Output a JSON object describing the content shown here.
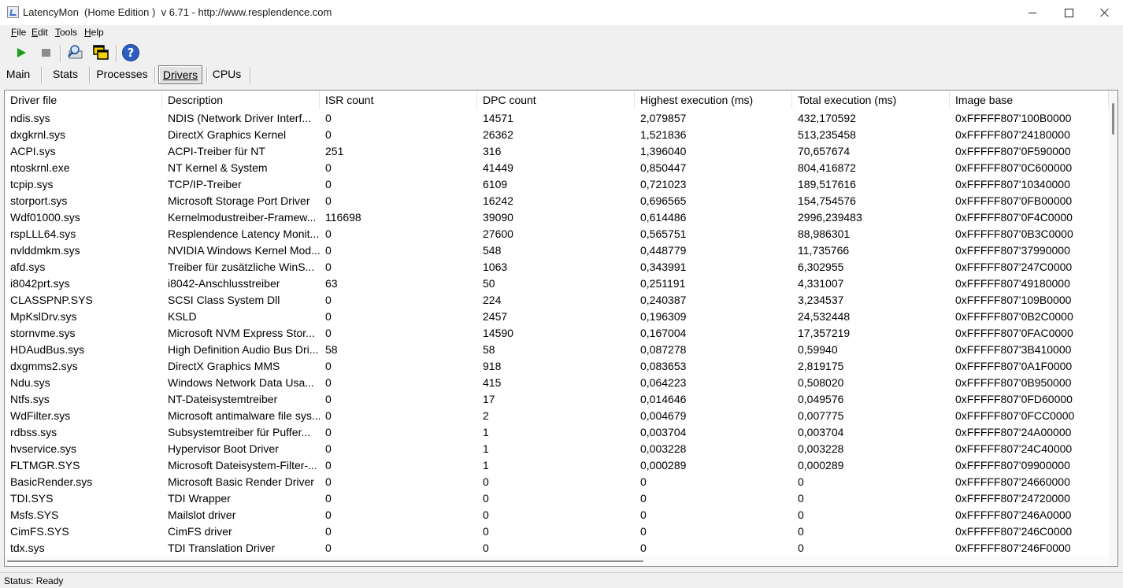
{
  "window": {
    "title": "LatencyMon  (Home Edition )  v 6.71 - http://www.resplendence.com"
  },
  "menu": [
    {
      "mnemonic": "F",
      "rest": "ile"
    },
    {
      "mnemonic": "E",
      "rest": "dit"
    },
    {
      "mnemonic": "T",
      "rest": "ools"
    },
    {
      "mnemonic": "H",
      "rest": "elp"
    }
  ],
  "toolbar": {
    "icons": [
      "play-icon",
      "stop-icon",
      "driver-search-icon",
      "windows-icon",
      "help-icon"
    ],
    "help_glyph": "?"
  },
  "tabs": [
    {
      "label": "Main",
      "active": false
    },
    {
      "label": "Stats",
      "active": false
    },
    {
      "label": "Processes",
      "active": false
    },
    {
      "label": "Drivers",
      "active": true
    },
    {
      "label": "CPUs",
      "active": false
    }
  ],
  "table": {
    "columns": [
      "Driver file",
      "Description",
      "ISR count",
      "DPC count",
      "Highest execution (ms)",
      "Total execution (ms)",
      "Image base"
    ],
    "rows": [
      [
        "ndis.sys",
        "NDIS (Network Driver Interf...",
        "0",
        "14571",
        "2,079857",
        "432,170592",
        "0xFFFFF807'100B0000"
      ],
      [
        "dxgkrnl.sys",
        "DirectX Graphics Kernel",
        "0",
        "26362",
        "1,521836",
        "513,235458",
        "0xFFFFF807'24180000"
      ],
      [
        "ACPI.sys",
        "ACPI-Treiber für NT",
        "251",
        "316",
        "1,396040",
        "70,657674",
        "0xFFFFF807'0F590000"
      ],
      [
        "ntoskrnl.exe",
        "NT Kernel & System",
        "0",
        "41449",
        "0,850447",
        "804,416872",
        "0xFFFFF807'0C600000"
      ],
      [
        "tcpip.sys",
        "TCP/IP-Treiber",
        "0",
        "6109",
        "0,721023",
        "189,517616",
        "0xFFFFF807'10340000"
      ],
      [
        "storport.sys",
        "Microsoft Storage Port Driver",
        "0",
        "16242",
        "0,696565",
        "154,754576",
        "0xFFFFF807'0FB00000"
      ],
      [
        "Wdf01000.sys",
        "Kernelmodustreiber-Framew...",
        "116698",
        "39090",
        "0,614486",
        "2996,239483",
        "0xFFFFF807'0F4C0000"
      ],
      [
        "rspLLL64.sys",
        "Resplendence Latency Monit...",
        "0",
        "27600",
        "0,565751",
        "88,986301",
        "0xFFFFF807'0B3C0000"
      ],
      [
        "nvlddmkm.sys",
        "NVIDIA Windows Kernel Mod...",
        "0",
        "548",
        "0,448779",
        "11,735766",
        "0xFFFFF807'37990000"
      ],
      [
        "afd.sys",
        "Treiber für zusätzliche WinS...",
        "0",
        "1063",
        "0,343991",
        "6,302955",
        "0xFFFFF807'247C0000"
      ],
      [
        "i8042prt.sys",
        "i8042-Anschlusstreiber",
        "63",
        "50",
        "0,251191",
        "4,331007",
        "0xFFFFF807'49180000"
      ],
      [
        "CLASSPNP.SYS",
        "SCSI Class System Dll",
        "0",
        "224",
        "0,240387",
        "3,234537",
        "0xFFFFF807'109B0000"
      ],
      [
        "MpKslDrv.sys",
        "KSLD",
        "0",
        "2457",
        "0,196309",
        "24,532448",
        "0xFFFFF807'0B2C0000"
      ],
      [
        "stornvme.sys",
        "Microsoft NVM Express Stor...",
        "0",
        "14590",
        "0,167004",
        "17,357219",
        "0xFFFFF807'0FAC0000"
      ],
      [
        "HDAudBus.sys",
        "High Definition Audio Bus Dri...",
        "58",
        "58",
        "0,087278",
        "0,59940",
        "0xFFFFF807'3B410000"
      ],
      [
        "dxgmms2.sys",
        "DirectX Graphics MMS",
        "0",
        "918",
        "0,083653",
        "2,819175",
        "0xFFFFF807'0A1F0000"
      ],
      [
        "Ndu.sys",
        "Windows Network Data Usa...",
        "0",
        "415",
        "0,064223",
        "0,508020",
        "0xFFFFF807'0B950000"
      ],
      [
        "Ntfs.sys",
        "NT-Dateisystemtreiber",
        "0",
        "17",
        "0,014646",
        "0,049576",
        "0xFFFFF807'0FD60000"
      ],
      [
        "WdFilter.sys",
        "Microsoft antimalware file sys...",
        "0",
        "2",
        "0,004679",
        "0,007775",
        "0xFFFFF807'0FCC0000"
      ],
      [
        "rdbss.sys",
        "Subsystemtreiber für Puffer...",
        "0",
        "1",
        "0,003704",
        "0,003704",
        "0xFFFFF807'24A00000"
      ],
      [
        "hvservice.sys",
        "Hypervisor Boot Driver",
        "0",
        "1",
        "0,003228",
        "0,003228",
        "0xFFFFF807'24C40000"
      ],
      [
        "FLTMGR.SYS",
        "Microsoft Dateisystem-Filter-...",
        "0",
        "1",
        "0,000289",
        "0,000289",
        "0xFFFFF807'09900000"
      ],
      [
        "BasicRender.sys",
        "Microsoft Basic Render Driver",
        "0",
        "0",
        "0",
        "0",
        "0xFFFFF807'24660000"
      ],
      [
        "TDI.SYS",
        "TDI Wrapper",
        "0",
        "0",
        "0",
        "0",
        "0xFFFFF807'24720000"
      ],
      [
        "Msfs.SYS",
        "Mailslot driver",
        "0",
        "0",
        "0",
        "0",
        "0xFFFFF807'246A0000"
      ],
      [
        "CimFS.SYS",
        "CimFS driver",
        "0",
        "0",
        "0",
        "0",
        "0xFFFFF807'246C0000"
      ],
      [
        "tdx.sys",
        "TDI Translation Driver",
        "0",
        "0",
        "0",
        "0",
        "0xFFFFF807'246F0000"
      ]
    ]
  },
  "status": {
    "text": "Status: Ready"
  }
}
